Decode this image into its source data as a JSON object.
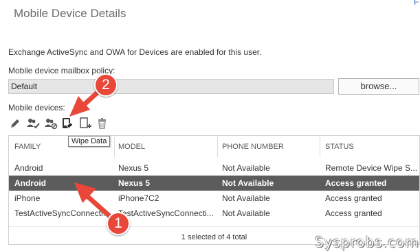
{
  "header": {
    "title": "Mobile Device Details",
    "corner_mark": "F"
  },
  "info_text": "Exchange ActiveSync and OWA for Devices are enabled for this user.",
  "policy": {
    "label": "Mobile device mailbox policy:",
    "value": "Default",
    "browse_label": "browse..."
  },
  "devices": {
    "label": "Mobile devices:",
    "toolbar": [
      {
        "icon": "pencil-icon",
        "action": "edit"
      },
      {
        "icon": "users-check-icon",
        "action": "allow"
      },
      {
        "icon": "users-block-icon",
        "action": "block"
      },
      {
        "icon": "wipe-data-icon",
        "action": "wipe data"
      },
      {
        "icon": "add-page-icon",
        "action": "add"
      },
      {
        "icon": "trash-icon",
        "action": "delete"
      }
    ],
    "tooltip": "Wipe Data",
    "columns": [
      "FAMILY",
      "MODEL",
      "PHONE NUMBER",
      "STATUS"
    ],
    "rows": [
      {
        "family": "Android",
        "model": "Nexus 5",
        "phone": "Not Available",
        "status": "Remote Device Wipe S..."
      },
      {
        "family": "Android",
        "model": "Nexus 5",
        "phone": "Not Available",
        "status": "Access granted"
      },
      {
        "family": "iPhone",
        "model": "iPhone7C2",
        "phone": "Not Available",
        "status": "Access granted"
      },
      {
        "family": "TestActiveSyncConnecti...",
        "model": "TestActiveSyncConnecti...",
        "phone": "Not Available",
        "status": "Access granted"
      }
    ],
    "selected_row": 2,
    "footer": "1 selected of 4 total"
  },
  "annotations": {
    "badge_1": "1",
    "badge_2": "2",
    "arrow_color": "#e8473a"
  },
  "watermark": "Sysprobs.com",
  "colors": {
    "selected_row_bg": "#5c5c5c",
    "icon_gray": "#555555"
  }
}
